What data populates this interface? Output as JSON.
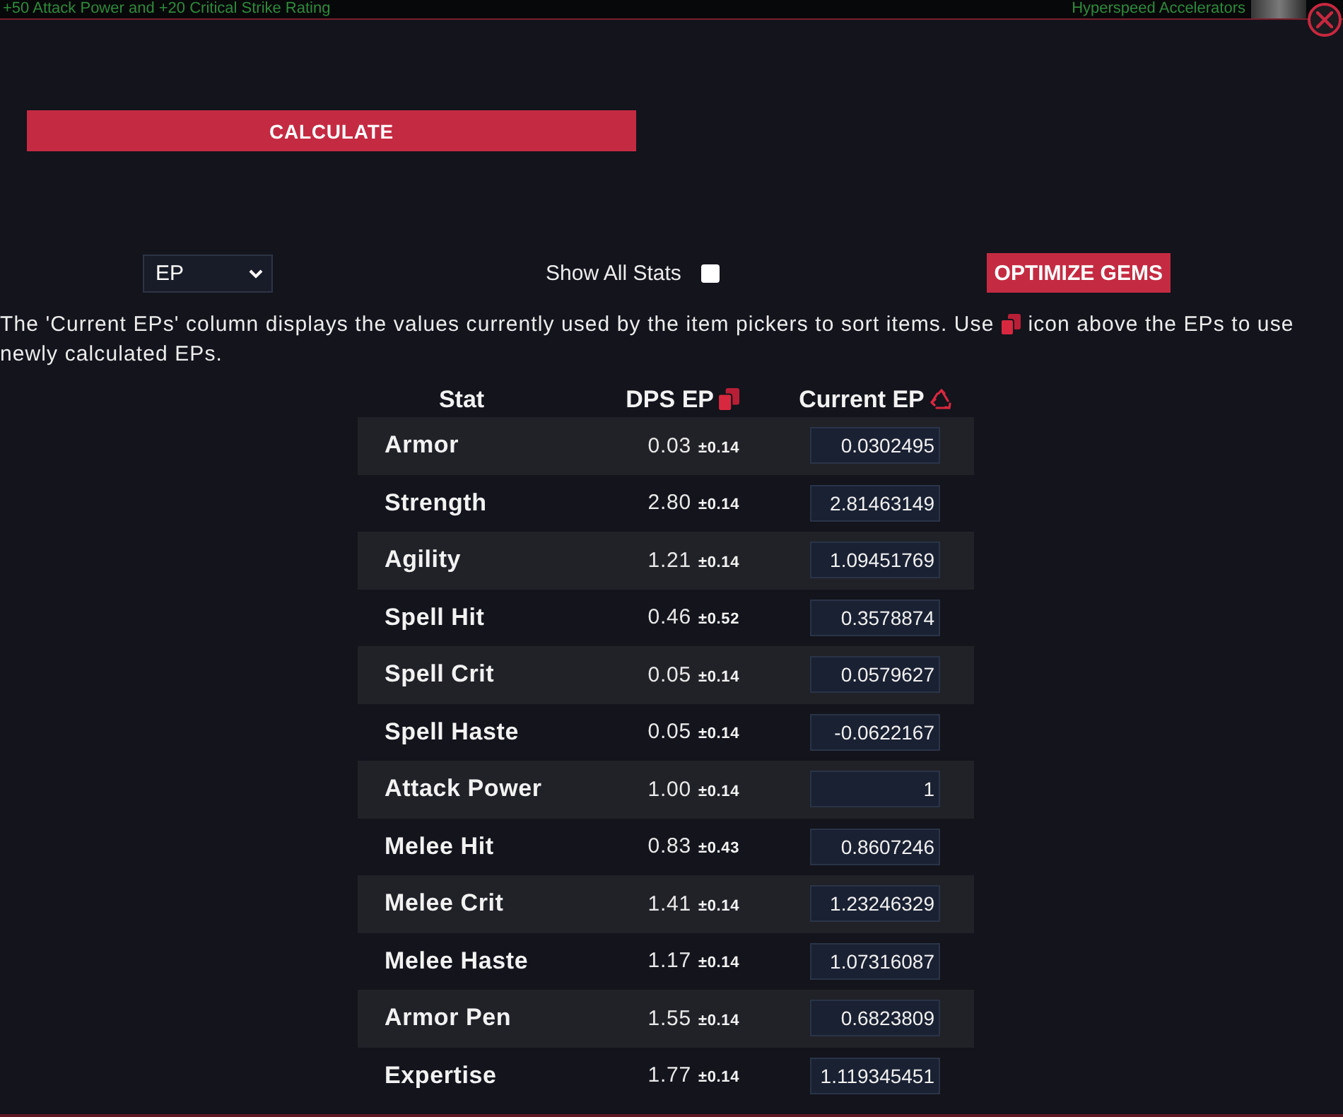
{
  "top_strip": {
    "bonus_text": "+50 Attack Power and +20 Critical Strike Rating",
    "item_name": "Hyperspeed Accelerators"
  },
  "calculate_button": "CALCULATE",
  "controls": {
    "ep_select": {
      "value": "EP"
    },
    "show_all_stats": {
      "label": "Show All Stats",
      "checked": false
    },
    "optimize_button": "OPTIMIZE GEMS"
  },
  "description": {
    "before_icon": "The 'Current EPs' column displays the values currently used by the item pickers to sort items. Use",
    "after_icon": "icon above the EPs to use",
    "second_line": "newly calculated EPs."
  },
  "table": {
    "header": {
      "stat": "Stat",
      "dps_ep": "DPS EP",
      "current_ep": "Current EP"
    },
    "rows": [
      {
        "stat": "Armor",
        "dps_ep": "0.03",
        "error": "±0.14",
        "current_ep": "0.0302495"
      },
      {
        "stat": "Strength",
        "dps_ep": "2.80",
        "error": "±0.14",
        "current_ep": "2.81463149"
      },
      {
        "stat": "Agility",
        "dps_ep": "1.21",
        "error": "±0.14",
        "current_ep": "1.09451769"
      },
      {
        "stat": "Spell Hit",
        "dps_ep": "0.46",
        "error": "±0.52",
        "current_ep": "0.3578874"
      },
      {
        "stat": "Spell Crit",
        "dps_ep": "0.05",
        "error": "±0.14",
        "current_ep": "0.0579627"
      },
      {
        "stat": "Spell Haste",
        "dps_ep": "0.05",
        "error": "±0.14",
        "current_ep": "-0.0622167"
      },
      {
        "stat": "Attack Power",
        "dps_ep": "1.00",
        "error": "±0.14",
        "current_ep": "1"
      },
      {
        "stat": "Melee Hit",
        "dps_ep": "0.83",
        "error": "±0.43",
        "current_ep": "0.8607246"
      },
      {
        "stat": "Melee Crit",
        "dps_ep": "1.41",
        "error": "±0.14",
        "current_ep": "1.23246329"
      },
      {
        "stat": "Melee Haste",
        "dps_ep": "1.17",
        "error": "±0.14",
        "current_ep": "1.07316087"
      },
      {
        "stat": "Armor Pen",
        "dps_ep": "1.55",
        "error": "±0.14",
        "current_ep": "0.6823809"
      },
      {
        "stat": "Expertise",
        "dps_ep": "1.77",
        "error": "±0.14",
        "current_ep": "1.119345451"
      }
    ]
  }
}
